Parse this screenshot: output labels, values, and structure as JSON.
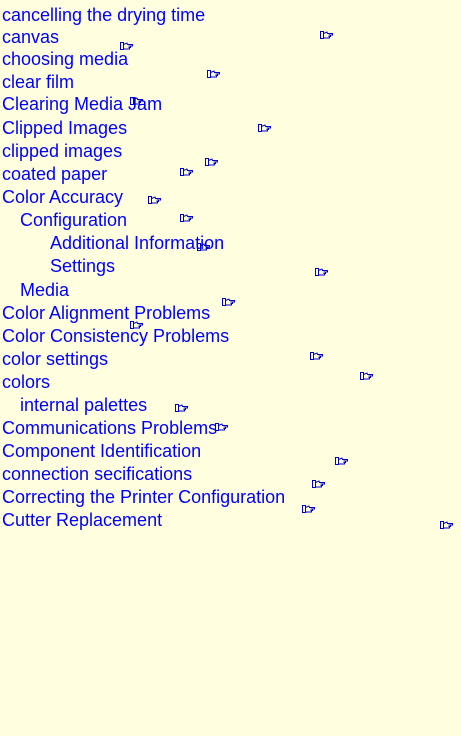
{
  "index_entries": [
    {
      "text": "cancelling the drying time",
      "level": 0
    },
    {
      "text": "canvas",
      "level": 0
    },
    {
      "text": "choosing media",
      "level": 0
    },
    {
      "text": "clear film",
      "level": 0
    },
    {
      "text": "Clearing Media Jam",
      "level": 0
    },
    {
      "text": "Clipped Images",
      "level": 0
    },
    {
      "text": "clipped images",
      "level": 0
    },
    {
      "text": "coated paper",
      "level": 0
    },
    {
      "text": "Color Accuracy",
      "level": 0
    },
    {
      "text": "Configuration",
      "level": 1
    },
    {
      "text": "Additional Information",
      "level": 2
    },
    {
      "text": "Settings",
      "level": 2
    },
    {
      "text": "Media",
      "level": 1
    },
    {
      "text": "Color Alignment Problems",
      "level": 0
    },
    {
      "text": "Color Consistency Problems",
      "level": 0
    },
    {
      "text": "color settings",
      "level": 0
    },
    {
      "text": "colors",
      "level": 0
    },
    {
      "text": "internal palettes",
      "level": 1
    },
    {
      "text": "Communications Problems",
      "level": 0
    },
    {
      "text": "Component Identification",
      "level": 0
    },
    {
      "text": "connection secifications",
      "level": 0
    },
    {
      "text": "Correcting the Printer Configuration",
      "level": 0
    },
    {
      "text": "Cutter Replacement",
      "level": 0
    }
  ],
  "link_icon": "pointing-hand-icon",
  "colors": {
    "background": "#FFFFE0",
    "link": "#0000FF",
    "icon": "#0000CC"
  }
}
